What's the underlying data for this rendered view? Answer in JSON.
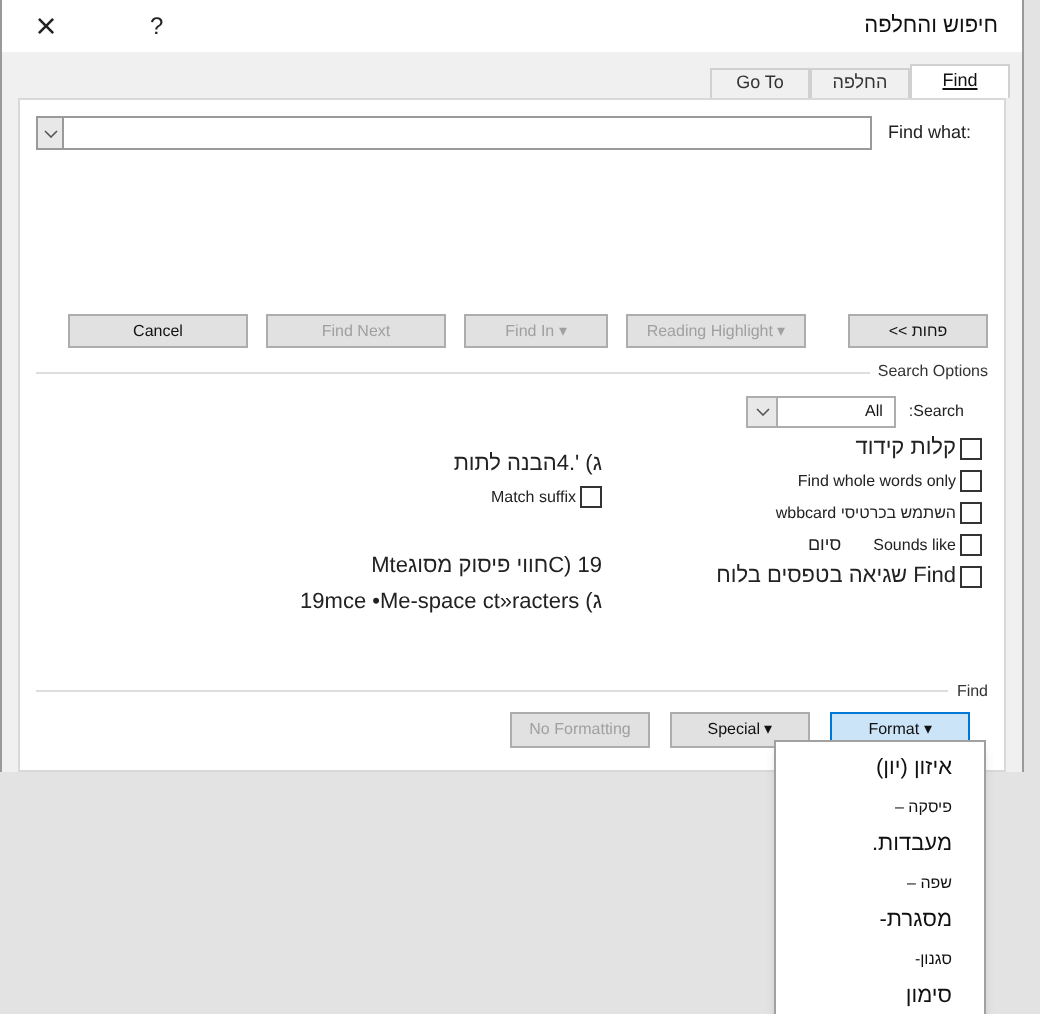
{
  "window": {
    "title": "חיפוש והחלפה",
    "help": "?",
    "close": "×"
  },
  "tabs": [
    {
      "label": "Find",
      "selected": true
    },
    {
      "label": "החלפה",
      "selected": false
    },
    {
      "label": "Go To",
      "selected": false
    }
  ],
  "find_what": {
    "label": "Find what:"
  },
  "buttons": [
    {
      "label": "<< פחות",
      "disabled": false
    },
    {
      "label": "Reading Highlight ▾",
      "disabled": true
    },
    {
      "label": "Find In ▾",
      "disabled": true
    },
    {
      "label": "Find Next",
      "disabled": true
    },
    {
      "label": "Cancel",
      "disabled": false
    }
  ],
  "search_options": {
    "title": "Search Options",
    "search_label": "Search:",
    "search_value": "All",
    "right_options": [
      {
        "label": "קלות קידוד",
        "checked": false
      },
      {
        "label": "Find whole words only",
        "checked": false
      },
      {
        "label": "השתמש בכרטיסי wbbcard",
        "checked": false
      },
      {
        "label": "Sounds like",
        "extra": "סיום",
        "checked": false
      },
      {
        "label": "Find שגיאה בטפסים בלוח",
        "checked": false
      }
    ],
    "left_items": [
      {
        "kind": "text",
        "label": "ג) '.4הבנה לתות"
      },
      {
        "kind": "checkbox",
        "label": "Match suffix",
        "checked": false
      },
      {
        "kind": "text",
        "label": "19 (Cחווי פיסוק מסוגMte"
      },
      {
        "kind": "text",
        "label": "ג) 19mce •Me-space ct»racters"
      }
    ]
  },
  "find_group": {
    "title": "Find",
    "buttons": [
      {
        "label": "Format ▾",
        "selected": true,
        "disabled": false
      },
      {
        "label": "Special ▾",
        "selected": false,
        "disabled": false
      },
      {
        "label": "No Formatting",
        "selected": false,
        "disabled": true
      }
    ]
  },
  "format_menu": [
    {
      "label": "איזון (יון)",
      "kind": "large"
    },
    {
      "label": "פיסקה –",
      "kind": "small"
    },
    {
      "label": "מעבדות.",
      "kind": "large"
    },
    {
      "label": "שפה –",
      "kind": "small"
    },
    {
      "label": "מסגרת-",
      "kind": "large"
    },
    {
      "label": "סגנון-",
      "kind": "small"
    },
    {
      "label": "סימון",
      "kind": "large"
    }
  ]
}
